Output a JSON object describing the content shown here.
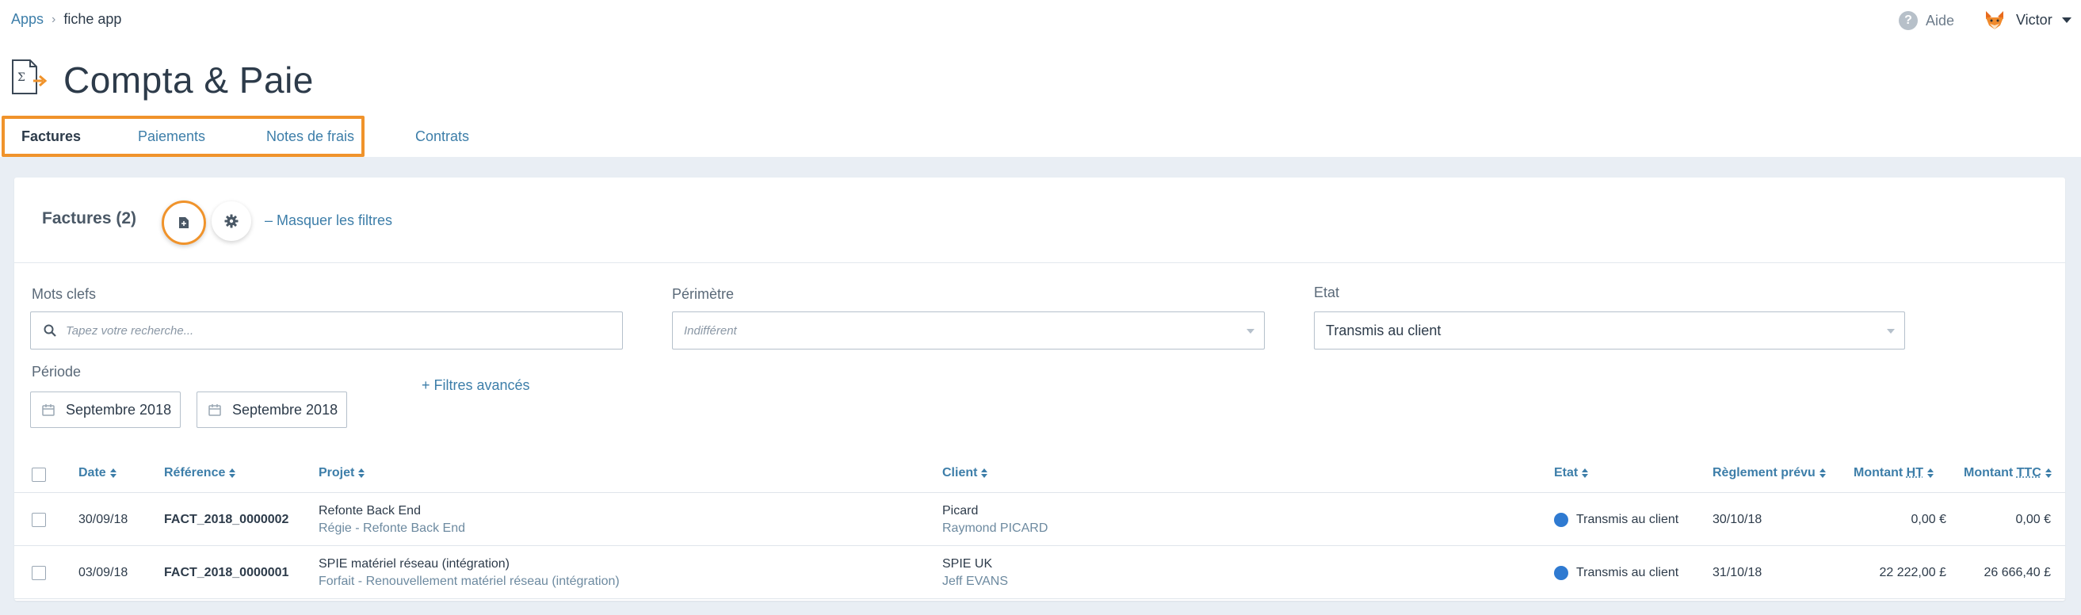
{
  "breadcrumb": {
    "root": "Apps",
    "current": "fiche app"
  },
  "header": {
    "help_label": "Aide",
    "user_name": "Victor",
    "title": "Compta & Paie"
  },
  "tabs": [
    {
      "label": "Factures",
      "active": true
    },
    {
      "label": "Paiements",
      "active": false
    },
    {
      "label": "Notes de frais",
      "active": false
    },
    {
      "label": "Contrats",
      "active": false
    }
  ],
  "card": {
    "title": "Factures (2)",
    "mask_filters": "– Masquer les filtres",
    "export_icon": "document-export-icon",
    "settings_icon": "gear-icon"
  },
  "filters": {
    "keywords_label": "Mots clefs",
    "keywords_placeholder": "Tapez votre recherche...",
    "scope_label": "Périmètre",
    "scope_value": "Indifférent",
    "state_label": "Etat",
    "state_value": "Transmis au client",
    "period_label": "Période",
    "period_start": "Septembre 2018",
    "period_end": "Septembre 2018",
    "advanced": "+ Filtres avancés"
  },
  "table": {
    "columns": {
      "date": "Date",
      "reference": "Référence",
      "project": "Projet",
      "client": "Client",
      "state": "Etat",
      "due": "Règlement prévu",
      "ht_prefix": "Montant ",
      "ht_abbr": "HT",
      "ttc_prefix": "Montant ",
      "ttc_abbr": "TTC"
    },
    "rows": [
      {
        "date": "30/09/18",
        "reference": "FACT_2018_0000002",
        "project": "Refonte Back End",
        "project_sub": "Régie  - Refonte Back End",
        "client": "Picard",
        "client_contact": "Raymond PICARD",
        "state": "Transmis au client",
        "state_color": "#2f7ad1",
        "due": "30/10/18",
        "amount_ht": "0,00 €",
        "amount_ttc": "0,00 €"
      },
      {
        "date": "03/09/18",
        "reference": "FACT_2018_0000001",
        "project": "SPIE matériel réseau (intégration)",
        "project_sub": "Forfait  - Renouvellement matériel réseau (intégration)",
        "client": "SPIE UK",
        "client_contact": "Jeff EVANS",
        "state": "Transmis au client",
        "state_color": "#2f7ad1",
        "due": "31/10/18",
        "amount_ht": "22 222,00 £",
        "amount_ttc": "26 666,40 £"
      }
    ]
  },
  "colors": {
    "accent": "#3d7ea9",
    "highlight": "#f0932b",
    "background": "#e9eef4"
  }
}
